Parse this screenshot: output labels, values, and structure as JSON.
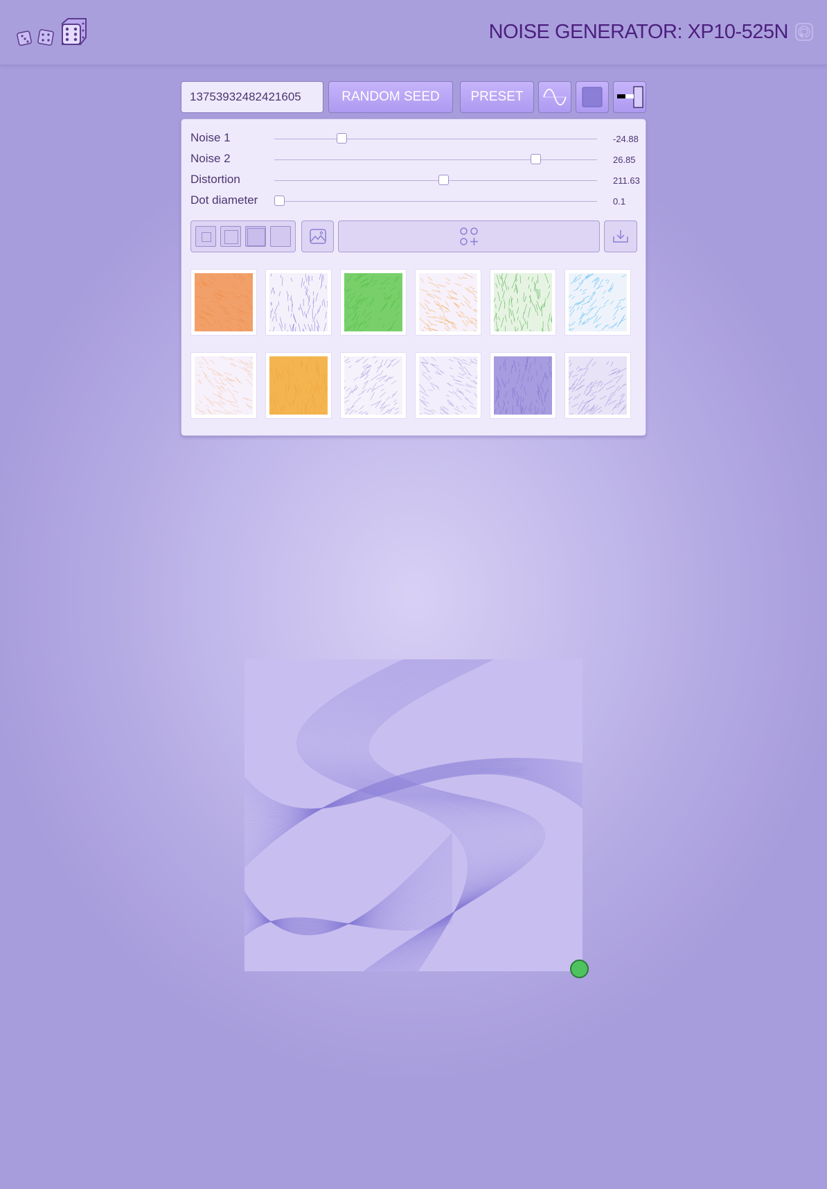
{
  "header": {
    "title": "NOISE GENERATOR: XP10-525N",
    "logo_icon": "dice-icon",
    "repo_icon": "github-icon"
  },
  "toolbar": {
    "seed_value": "13753932482421605",
    "random_seed_label": "RANDOM SEED",
    "preset_label": "PRESET",
    "wave_icon": "sine-wave-icon",
    "color_icon": "color-swatch-icon",
    "contrast_icon": "contrast-toggle-icon"
  },
  "sliders": [
    {
      "label": "Noise 1",
      "value": "-24.88",
      "position": 0.2
    },
    {
      "label": "Noise 2",
      "value": "26.85",
      "position": 0.82
    },
    {
      "label": "Distortion",
      "value": "211.63",
      "position": 0.526
    },
    {
      "label": "Dot diameter",
      "value": "0.1",
      "position": 0.0
    }
  ],
  "controls": {
    "size_options": [
      "small",
      "medium",
      "large",
      "full"
    ],
    "image_icon": "image-icon",
    "gallery_icon": "grid-plus-icon",
    "download_icon": "download-icon"
  },
  "presets": [
    {
      "color": "#ec8a45",
      "bg": "#f2a069"
    },
    {
      "color": "#7d6fd0",
      "bg": "#f4f1fb"
    },
    {
      "color": "#4cb847",
      "bg": "#79d06a"
    },
    {
      "color": "#f3a64a",
      "bg": "#f7f1fb"
    },
    {
      "color": "#3ea53a",
      "bg": "#e6f3e2"
    },
    {
      "color": "#48b6f0",
      "bg": "#eef3fb"
    },
    {
      "color": "#f5c09c",
      "bg": "#f7f1fb"
    },
    {
      "color": "#eea43a",
      "bg": "#f4b44f"
    },
    {
      "color": "#9f95d8",
      "bg": "#f5f2fc"
    },
    {
      "color": "#a79dde",
      "bg": "#f2eefb"
    },
    {
      "color": "#7b6fd0",
      "bg": "#a79cdf"
    },
    {
      "color": "#958bd6",
      "bg": "#e8e3f7"
    }
  ],
  "colors": {
    "accent": "#b29ef4",
    "stroke": "#8a7ed6",
    "status_dot": "#4fc260"
  }
}
